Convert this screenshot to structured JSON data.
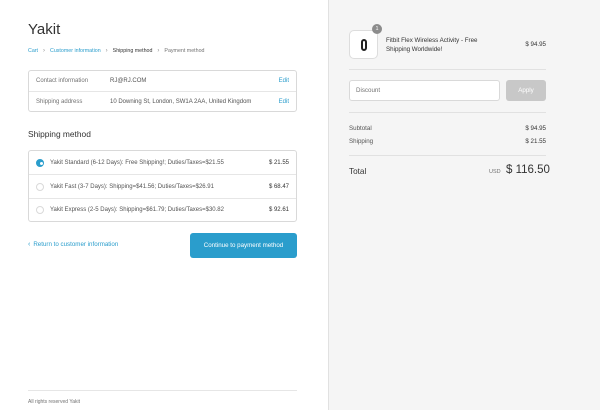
{
  "brand": "Yakit",
  "breadcrumb": {
    "cart": "Cart",
    "customer_information": "Customer information",
    "shipping_method": "Shipping method",
    "payment_method": "Payment method"
  },
  "review": {
    "contact": {
      "label": "Contact information",
      "value": "RJ@RJ.COM",
      "edit": "Edit"
    },
    "shipping": {
      "label": "Shipping address",
      "value": "10 Downing St, London, SW1A 2AA, United Kingdom",
      "edit": "Edit"
    }
  },
  "shipping_section_title": "Shipping method",
  "shipping_methods": [
    {
      "label": "Yakit Standard (6-12 Days): Free Shipping!; Duties/Taxes=$21.55",
      "price": "$ 21.55",
      "selected": true
    },
    {
      "label": "Yakit Fast (3-7 Days): Shipping=$41.56; Duties/Taxes=$26.91",
      "price": "$ 68.47",
      "selected": false
    },
    {
      "label": "Yakit Express (2-5 Days): Shipping=$61.79; Duties/Taxes=$30.82",
      "price": "$ 92.61",
      "selected": false
    }
  ],
  "return_link": "Return to customer information",
  "continue_button": "Continue to payment method",
  "footer": "All rights reserved Yakit",
  "order": {
    "product": {
      "quantity": "1",
      "name": "Fitbit Flex Wireless Activity - Free Shipping Worldwide!",
      "price": "$ 94.95"
    },
    "discount": {
      "placeholder": "Discount",
      "apply_label": "Apply"
    },
    "subtotal": {
      "label": "Subtotal",
      "value": "$ 94.95"
    },
    "shipping": {
      "label": "Shipping",
      "value": "$ 21.55"
    },
    "total": {
      "label": "Total",
      "currency": "USD",
      "amount": "$ 116.50"
    }
  },
  "colors": {
    "accent": "#2a9dcc",
    "sidebar_bg": "#f5f5f5",
    "apply_disabled": "#c8c8c8"
  }
}
